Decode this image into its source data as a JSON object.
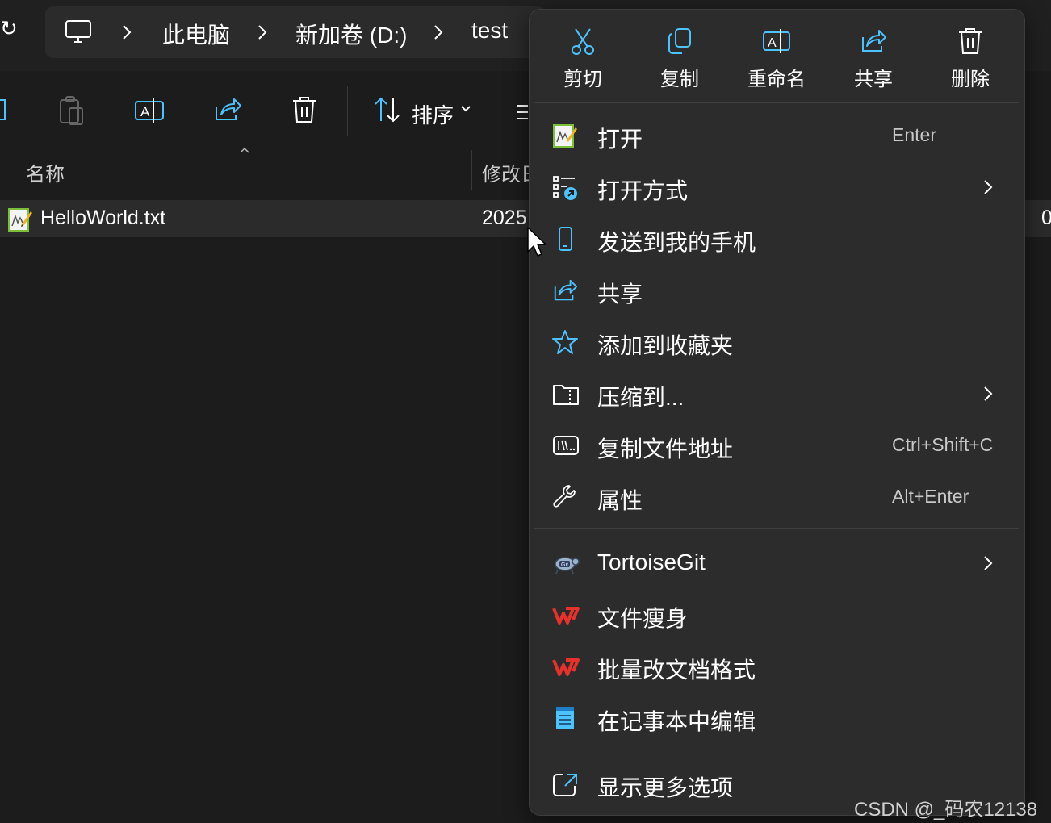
{
  "breadcrumb": {
    "items": [
      "此电脑",
      "新加卷 (D:)",
      "test"
    ]
  },
  "toolbar": {
    "sort_label": "排序"
  },
  "file_list": {
    "columns": [
      "名称",
      "修改日"
    ],
    "rows": [
      {
        "name": "HelloWorld.txt",
        "modified": "2025",
        "extra": "0"
      }
    ]
  },
  "context_menu": {
    "quick_actions": [
      {
        "label": "剪切",
        "icon": "scissors-icon"
      },
      {
        "label": "复制",
        "icon": "copy-icon"
      },
      {
        "label": "重命名",
        "icon": "rename-icon"
      },
      {
        "label": "共享",
        "icon": "share-icon"
      },
      {
        "label": "删除",
        "icon": "trash-icon"
      }
    ],
    "items": [
      {
        "label": "打开",
        "shortcut": "Enter",
        "icon": "notepad-file-icon"
      },
      {
        "label": "打开方式",
        "shortcut": "",
        "icon": "open-with-icon",
        "submenu": true
      },
      {
        "label": "发送到我的手机",
        "shortcut": "",
        "icon": "phone-icon"
      },
      {
        "label": "共享",
        "shortcut": "",
        "icon": "share-icon"
      },
      {
        "label": "添加到收藏夹",
        "shortcut": "",
        "icon": "star-icon"
      },
      {
        "label": "压缩到...",
        "shortcut": "",
        "icon": "zip-folder-icon",
        "submenu": true
      },
      {
        "label": "复制文件地址",
        "shortcut": "Ctrl+Shift+C",
        "icon": "copy-path-icon"
      },
      {
        "label": "属性",
        "shortcut": "Alt+Enter",
        "icon": "wrench-icon"
      },
      {
        "label": "TortoiseGit",
        "shortcut": "",
        "icon": "tortoisegit-icon",
        "submenu": true
      },
      {
        "label": "文件瘦身",
        "shortcut": "",
        "icon": "wps-icon"
      },
      {
        "label": "批量改文档格式",
        "shortcut": "",
        "icon": "wps-icon"
      },
      {
        "label": "在记事本中编辑",
        "shortcut": "",
        "icon": "notepad-icon"
      },
      {
        "label": "显示更多选项",
        "shortcut": "",
        "icon": "more-options-icon"
      }
    ]
  },
  "watermark": "CSDN @_码农12138",
  "colors": {
    "background": "#1c1c1c",
    "menu_background": "#2c2c2c",
    "selected_row": "#2b2b2b",
    "accent": "#4cc2ff",
    "wps_red": "#e8312b"
  }
}
